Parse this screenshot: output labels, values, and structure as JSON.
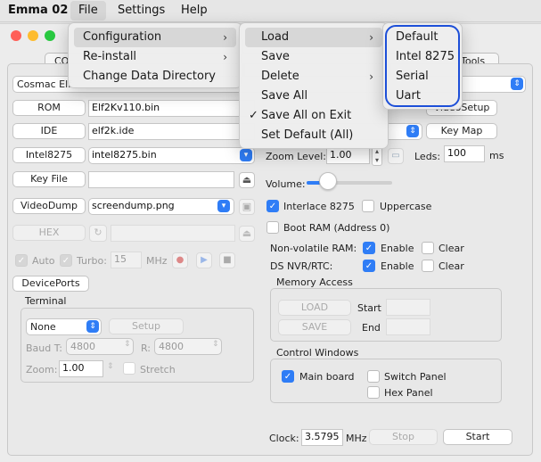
{
  "menubar": {
    "app": "Emma 02",
    "items": [
      "File",
      "Settings",
      "Help"
    ]
  },
  "file_menu": {
    "items": [
      "Configuration",
      "Re-install",
      "Change Data Directory"
    ]
  },
  "config_menu": {
    "items": [
      "Load",
      "Save",
      "Delete",
      "Save All",
      "Save All on Exit",
      "Set Default (All)"
    ],
    "checked": "Save All on Exit"
  },
  "load_menu": {
    "items": [
      "Default",
      "Intel 8275",
      "Serial",
      "Uart"
    ]
  },
  "tabs": {
    "left_partial": "CO",
    "right_partial": "Tools"
  },
  "computer_select": {
    "value": "Cosmac Elf"
  },
  "files": [
    {
      "button": "ROM",
      "value": "Elf2Kv110.bin"
    },
    {
      "button": "IDE",
      "value": "elf2k.ide"
    },
    {
      "button": "Intel8275",
      "value": "intel8275.bin"
    },
    {
      "button": "Key File",
      "value": ""
    },
    {
      "button": "VideoDump",
      "value": "screendump.png"
    },
    {
      "button": "HEX",
      "value": ""
    }
  ],
  "right_buttons": {
    "setup": "VideoSetup",
    "keymap": "Key Map"
  },
  "zoom": {
    "label": "Zoom Level:",
    "value": "1.00"
  },
  "leds": {
    "label": "Leds:",
    "value": "100",
    "unit": "ms"
  },
  "volume": {
    "label": "Volume:",
    "level": 0.25
  },
  "options": {
    "interlace": "Interlace 8275",
    "uppercase": "Uppercase",
    "boot_ram": "Boot RAM (Address 0)",
    "nonvolatile": "Non-volatile RAM:",
    "ds_nvr": "DS NVR/RTC:",
    "enable": "Enable",
    "clear": "Clear"
  },
  "run_row": {
    "auto": "Auto",
    "turbo": "Turbo:",
    "turbo_value": "15",
    "mhz": "MHz"
  },
  "device_ports": "DevicePorts",
  "terminal": {
    "title": "Terminal",
    "type": "None",
    "setup": "Setup",
    "baud_t_label": "Baud T:",
    "baud_t": "4800",
    "baud_r_label": "R:",
    "baud_r": "4800",
    "zoom_label": "Zoom:",
    "zoom": "1.00",
    "stretch": "Stretch"
  },
  "memory": {
    "title": "Memory Access",
    "load": "LOAD",
    "save": "SAVE",
    "start": "Start",
    "end": "End"
  },
  "control_windows": {
    "title": "Control Windows",
    "main_board": "Main board",
    "switch_panel": "Switch Panel",
    "hex_panel": "Hex Panel"
  },
  "clock": {
    "label": "Clock:",
    "value": "3.5795",
    "unit": "MHz",
    "stop": "Stop",
    "start": "Start"
  },
  "colors": {
    "accent": "#2f7df6",
    "highlight_ring": "#1d4fd8"
  }
}
